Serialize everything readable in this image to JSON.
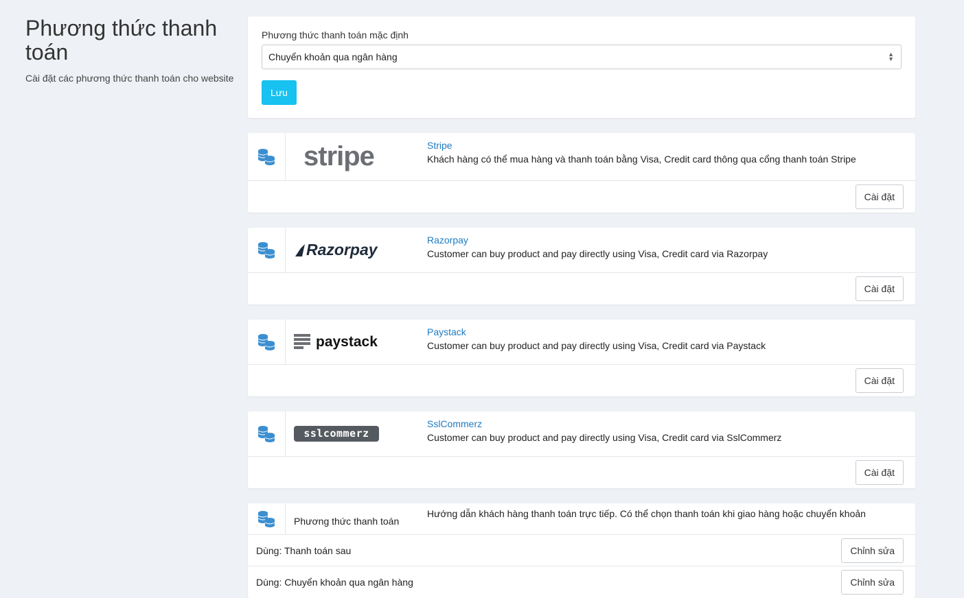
{
  "page": {
    "title": "Phương thức thanh toán",
    "subtitle": "Cài đặt các phương thức thanh toán cho website"
  },
  "default_method": {
    "label": "Phương thức thanh toán mặc định",
    "selected": "Chuyển khoản qua ngân hàng",
    "save_label": "Lưu"
  },
  "methods": [
    {
      "name": "Stripe",
      "logo_text": "stripe",
      "description": "Khách hàng có thể mua hàng và thanh toán bằng Visa, Credit card thông qua cổng thanh toán Stripe",
      "button": "Cài đặt"
    },
    {
      "name": "Razorpay",
      "logo_text": "Razorpay",
      "description": "Customer can buy product and pay directly using Visa, Credit card via Razorpay",
      "button": "Cài đặt"
    },
    {
      "name": "Paystack",
      "logo_text": "paystack",
      "description": "Customer can buy product and pay directly using Visa, Credit card via Paystack",
      "button": "Cài đặt"
    },
    {
      "name": "SslCommerz",
      "logo_text": "sslcommerz",
      "description": "Customer can buy product and pay directly using Visa, Credit card via SslCommerz",
      "button": "Cài đặt"
    }
  ],
  "offline": {
    "label": "Phương thức thanh toán",
    "description": "Hướng dẫn khách hàng thanh toán trực tiếp. Có thể chọn thanh toán khi giao hàng hoặc chuyển khoản",
    "rows": [
      {
        "label": "Dùng: Thanh toán sau",
        "button": "Chỉnh sửa"
      },
      {
        "label": "Dùng: Chuyển khoản qua ngân hàng",
        "button": "Chỉnh sửa"
      }
    ]
  },
  "colors": {
    "accent": "#17c1f0",
    "link": "#1f7bc0",
    "icon": "#3b8fd0",
    "background": "#eef1f5"
  },
  "icons": {
    "method_icon": "coins-stack-icon"
  }
}
